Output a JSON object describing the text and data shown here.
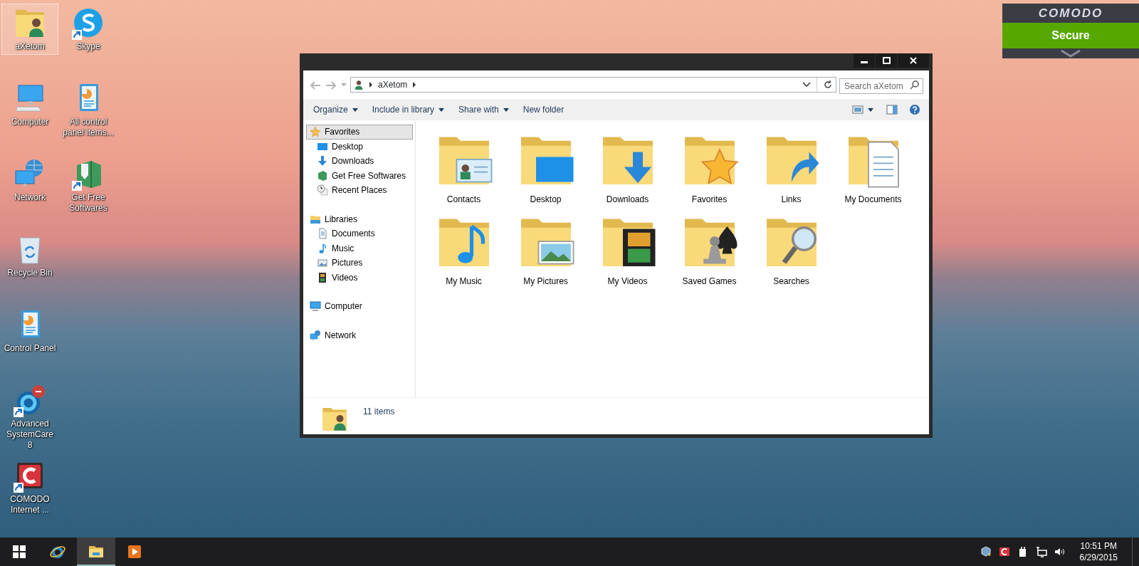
{
  "desktop_rows": [
    {
      "icons": [
        {
          "label": "aXetom",
          "kind": "user-folder",
          "shortcut": false,
          "selected": true
        },
        {
          "label": "Skype",
          "kind": "skype",
          "shortcut": true,
          "selected": false
        }
      ]
    },
    {
      "icons": [
        {
          "label": "Computer",
          "kind": "computer",
          "shortcut": false,
          "selected": false
        },
        {
          "label": "All control panel items...",
          "kind": "control-panel",
          "shortcut": false,
          "selected": false
        }
      ]
    },
    {
      "icons": [
        {
          "label": "Network",
          "kind": "network",
          "shortcut": false,
          "selected": false
        },
        {
          "label": "Get Free Softwares",
          "kind": "package",
          "shortcut": true,
          "selected": false
        }
      ]
    },
    {
      "icons": [
        {
          "label": "Recycle Bin",
          "kind": "recycle-bin",
          "shortcut": false,
          "selected": false
        }
      ]
    },
    {
      "icons": [
        {
          "label": "Control Panel",
          "kind": "control-panel",
          "shortcut": false,
          "selected": false
        }
      ]
    },
    {
      "icons": [
        {
          "label": "Advanced SystemCare 8",
          "kind": "systemcare",
          "shortcut": true,
          "selected": false
        }
      ]
    },
    {
      "icons": [
        {
          "label": "COMODO Internet ...",
          "kind": "comodo",
          "shortcut": true,
          "selected": false
        }
      ]
    }
  ],
  "security_widget": {
    "brand": "COMODO",
    "status": "Secure"
  },
  "window": {
    "history": {
      "back_enabled": false,
      "forward_enabled": false
    },
    "breadcrumb": [
      "aXetom"
    ],
    "search": {
      "placeholder": "Search aXetom"
    },
    "commands": [
      {
        "label": "Organize",
        "menu": true
      },
      {
        "label": "Include in library",
        "menu": true
      },
      {
        "label": "Share with",
        "menu": true
      },
      {
        "label": "New folder",
        "menu": false
      }
    ],
    "nav_groups": [
      {
        "label": "Favorites",
        "kind": "star",
        "selected": true,
        "children": [
          {
            "label": "Desktop",
            "kind": "desktop",
            "selected": false
          },
          {
            "label": "Downloads",
            "kind": "downloads",
            "selected": false
          },
          {
            "label": "Get Free Softwares",
            "kind": "package",
            "selected": false
          },
          {
            "label": "Recent Places",
            "kind": "recent",
            "selected": false
          }
        ]
      },
      {
        "label": "Libraries",
        "kind": "library",
        "selected": false,
        "children": [
          {
            "label": "Documents",
            "kind": "documents",
            "selected": false
          },
          {
            "label": "Music",
            "kind": "music",
            "selected": false
          },
          {
            "label": "Pictures",
            "kind": "pictures",
            "selected": false
          },
          {
            "label": "Videos",
            "kind": "videos",
            "selected": false
          }
        ]
      },
      {
        "label": "Computer",
        "kind": "computer",
        "selected": false
      },
      {
        "label": "Network",
        "kind": "network",
        "selected": false
      }
    ],
    "items": [
      {
        "label": "Contacts",
        "kind": "contacts"
      },
      {
        "label": "Desktop",
        "kind": "desktop"
      },
      {
        "label": "Downloads",
        "kind": "downloads"
      },
      {
        "label": "Favorites",
        "kind": "favorites"
      },
      {
        "label": "Links",
        "kind": "links"
      },
      {
        "label": "My Documents",
        "kind": "documents"
      },
      {
        "label": "My Music",
        "kind": "music"
      },
      {
        "label": "My Pictures",
        "kind": "pictures"
      },
      {
        "label": "My Videos",
        "kind": "videos"
      },
      {
        "label": "Saved Games",
        "kind": "games"
      },
      {
        "label": "Searches",
        "kind": "searches"
      }
    ],
    "status": "11 items"
  },
  "taskbar": {
    "apps": [
      {
        "kind": "ie",
        "active": false
      },
      {
        "kind": "explorer",
        "active": true
      },
      {
        "kind": "media",
        "active": false
      }
    ],
    "tray": [
      {
        "kind": "cube"
      },
      {
        "kind": "comodo"
      },
      {
        "kind": "power"
      },
      {
        "kind": "network"
      },
      {
        "kind": "speaker"
      }
    ],
    "time": "10:51 PM",
    "date": "6/29/2015"
  }
}
